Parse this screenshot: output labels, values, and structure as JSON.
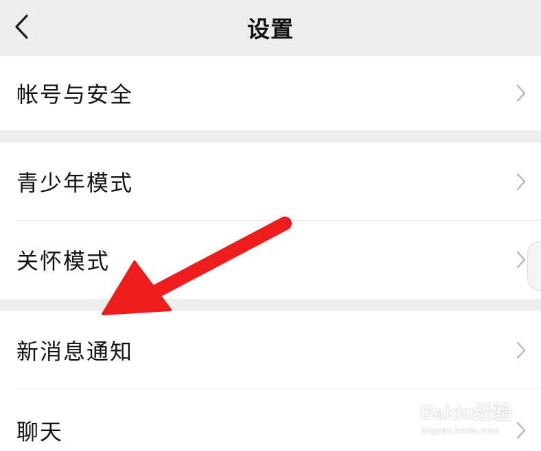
{
  "header": {
    "title": "设置",
    "back_icon": "chevron-left-icon"
  },
  "settings": {
    "group1": [
      {
        "label": "帐号与安全"
      }
    ],
    "group2": [
      {
        "label": "青少年模式"
      },
      {
        "label": "关怀模式"
      }
    ],
    "group3": [
      {
        "label": "新消息通知"
      },
      {
        "label": "聊天"
      }
    ]
  },
  "annotation": {
    "arrow_color": "#ee1c1c",
    "points_to": "新消息通知"
  },
  "watermark": {
    "logo": "Baidu经验",
    "url": "jingyan.baidu.com"
  }
}
